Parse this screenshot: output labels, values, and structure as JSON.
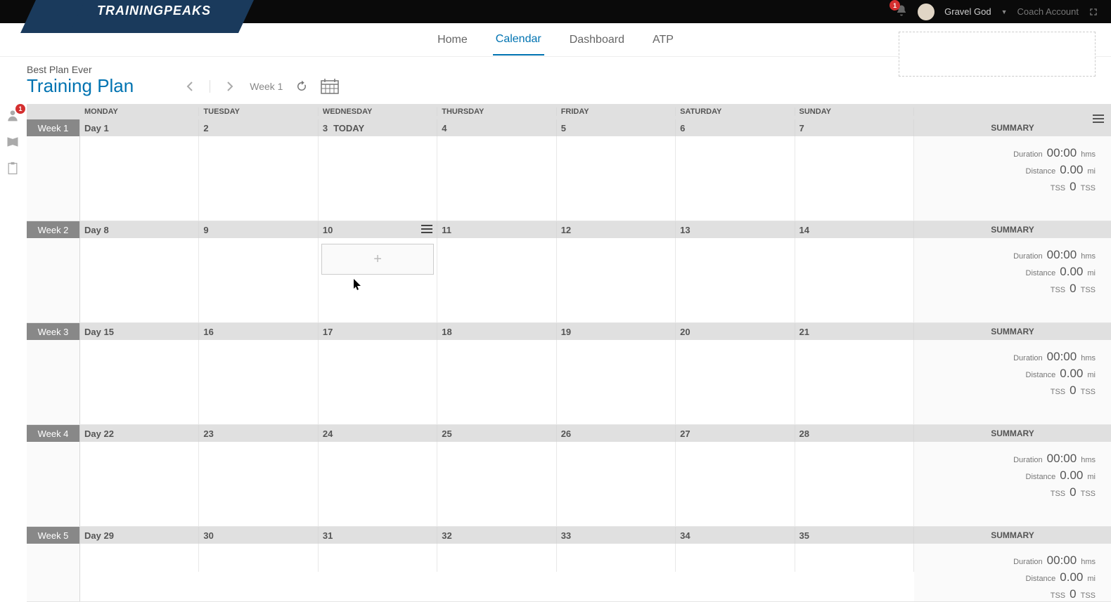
{
  "topbar": {
    "logo": "TRAININGPEAKS",
    "notification_count": "1",
    "username": "Gravel God",
    "coach_account": "Coach Account"
  },
  "nav": {
    "items": [
      {
        "label": "Home",
        "active": false
      },
      {
        "label": "Calendar",
        "active": true
      },
      {
        "label": "Dashboard",
        "active": false
      },
      {
        "label": "ATP",
        "active": false
      }
    ]
  },
  "plan": {
    "subtitle": "Best Plan Ever",
    "title": "Training Plan",
    "week_label": "Week 1"
  },
  "sidebar": {
    "badge": "1"
  },
  "calendar": {
    "day_headers": [
      "MONDAY",
      "TUESDAY",
      "WEDNESDAY",
      "THURSDAY",
      "FRIDAY",
      "SATURDAY",
      "SUNDAY"
    ],
    "summary_label": "SUMMARY",
    "today_label": "TODAY",
    "weeks": [
      {
        "label": "Week 1",
        "days": [
          "Day 1",
          "2",
          "3",
          "4",
          "5",
          "6",
          "7"
        ],
        "today_index": 2,
        "hover_index": -1
      },
      {
        "label": "Week 2",
        "days": [
          "Day 8",
          "9",
          "10",
          "11",
          "12",
          "13",
          "14"
        ],
        "today_index": -1,
        "hover_index": 2
      },
      {
        "label": "Week 3",
        "days": [
          "Day 15",
          "16",
          "17",
          "18",
          "19",
          "20",
          "21"
        ],
        "today_index": -1,
        "hover_index": -1
      },
      {
        "label": "Week 4",
        "days": [
          "Day 22",
          "23",
          "24",
          "25",
          "26",
          "27",
          "28"
        ],
        "today_index": -1,
        "hover_index": -1
      },
      {
        "label": "Week 5",
        "days": [
          "Day 29",
          "30",
          "31",
          "32",
          "33",
          "34",
          "35"
        ],
        "today_index": -1,
        "hover_index": -1
      }
    ],
    "summary_template": {
      "duration_label": "Duration",
      "duration_val": "00:00",
      "duration_unit": "hms",
      "distance_label": "Distance",
      "distance_val": "0.00",
      "distance_unit": "mi",
      "tss_label": "TSS",
      "tss_val": "0",
      "tss_unit": "TSS"
    }
  }
}
